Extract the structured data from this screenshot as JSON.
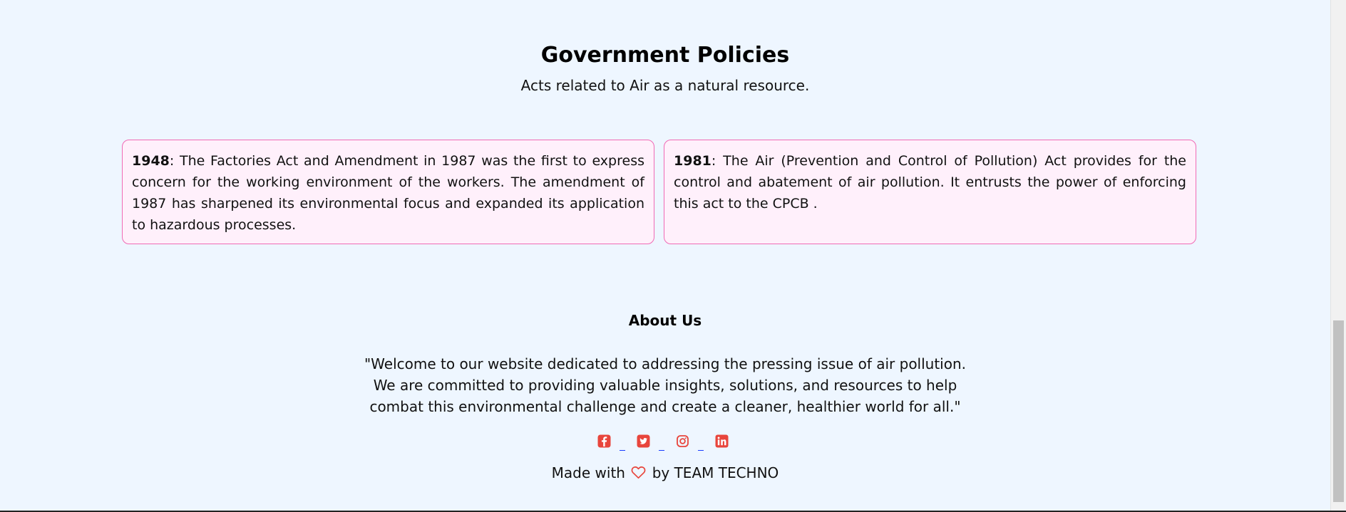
{
  "policies": {
    "title": "Government Policies",
    "subtitle": "Acts related to Air as a natural resource.",
    "cards": [
      {
        "year": "1948",
        "text": ": The Factories Act and Amendment in 1987 was the first to express concern for the working environment of the workers. The amendment of 1987 has sharpened its environmental focus and expanded its application to hazardous processes."
      },
      {
        "year": "1981",
        "text": ": The Air (Prevention and Control of Pollution) Act provides for the control and abatement of air pollution. It entrusts the power of enforcing this act to the CPCB ."
      }
    ]
  },
  "about": {
    "title": "About Us",
    "text": "\"Welcome to our website dedicated to addressing the pressing issue of air pollution. We are committed to providing valuable insights, solutions, and resources to help combat this environmental challenge and create a cleaner, healthier world for all.\""
  },
  "social": {
    "icons": [
      "facebook-icon",
      "twitter-icon",
      "instagram-icon",
      "linkedin-icon"
    ],
    "icon_color": "#e8453c",
    "link_color": "#1a3cff"
  },
  "footer": {
    "prefix": "Made with",
    "suffix": "by TEAM TECHNO",
    "heart_color": "#e8453c"
  },
  "colors": {
    "background": "#eef6ff",
    "card_background": "#fff0fb",
    "card_border": "#f06ab5"
  }
}
